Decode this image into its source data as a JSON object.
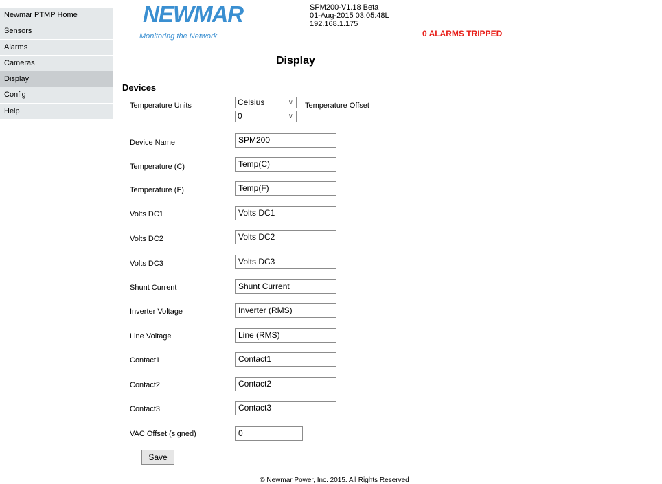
{
  "sidebar": {
    "items": [
      {
        "label": "Newmar PTMP Home"
      },
      {
        "label": "Sensors"
      },
      {
        "label": "Alarms"
      },
      {
        "label": "Cameras"
      },
      {
        "label": "Display"
      },
      {
        "label": "Config"
      },
      {
        "label": "Help"
      }
    ],
    "active": "Display"
  },
  "header": {
    "logo_brand": "NEWMAR",
    "logo_tagline": "Monitoring the Network",
    "firmware": "SPM200-V1.18 Beta",
    "datetime": "01-Aug-2015 03:05:48L",
    "ip": "192.168.1.175",
    "alarms": "0 ALARMS TRIPPED"
  },
  "page": {
    "title": "Display",
    "section": "Devices"
  },
  "form": {
    "temperature_units": {
      "label": "Temperature Units",
      "value": "Celsius"
    },
    "temperature_offset": {
      "label": "Temperature Offset",
      "value": "0"
    },
    "fields": [
      {
        "label": "Device Name",
        "value": "SPM200"
      },
      {
        "label": "Temperature (C)",
        "value": "Temp(C)"
      },
      {
        "label": "Temperature (F)",
        "value": "Temp(F)"
      },
      {
        "label": "Volts DC1",
        "value": "Volts DC1"
      },
      {
        "label": "Volts DC2",
        "value": "Volts DC2"
      },
      {
        "label": "Volts DC3",
        "value": "Volts DC3"
      },
      {
        "label": "Shunt Current",
        "value": "Shunt Current"
      },
      {
        "label": "Inverter Voltage",
        "value": "Inverter (RMS)"
      },
      {
        "label": "Line Voltage",
        "value": "Line (RMS)"
      },
      {
        "label": "Contact1",
        "value": "Contact1"
      },
      {
        "label": "Contact2",
        "value": "Contact2"
      },
      {
        "label": "Contact3",
        "value": "Contact3"
      },
      {
        "label": "VAC Offset (signed)",
        "value": "0"
      }
    ],
    "save_label": "Save"
  },
  "footer": {
    "copyright": "© Newmar Power, Inc. 2015. All Rights Reserved"
  },
  "colors": {
    "brand": "#3a8fd1",
    "alarm": "#e8201a",
    "nav_bg": "#e4e8ea",
    "nav_active_bg": "#c9cdd0"
  },
  "icons": {
    "select_chevron": "chevron-down-icon"
  }
}
